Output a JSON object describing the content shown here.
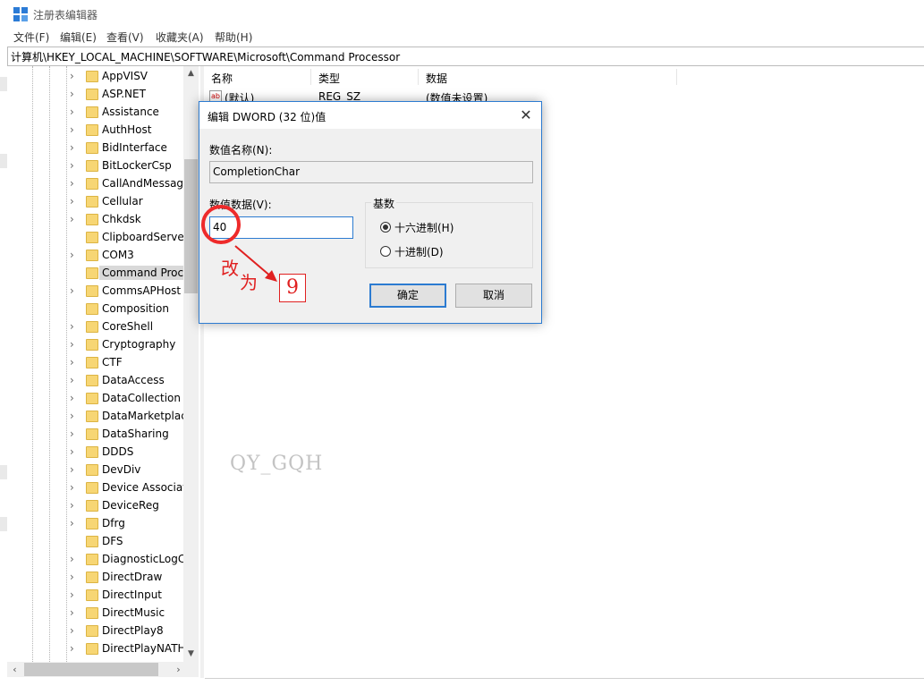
{
  "window": {
    "title": "注册表编辑器",
    "icon": "registry-editor-icon"
  },
  "menu": [
    "文件(F)",
    "编辑(E)",
    "查看(V)",
    "收藏夹(A)",
    "帮助(H)"
  ],
  "address": "计算机\\HKEY_LOCAL_MACHINE\\SOFTWARE\\Microsoft\\Command Processor",
  "tree": {
    "items": [
      {
        "label": "AppVISV",
        "expandable": true
      },
      {
        "label": "ASP.NET",
        "expandable": true
      },
      {
        "label": "Assistance",
        "expandable": true
      },
      {
        "label": "AuthHost",
        "expandable": true
      },
      {
        "label": "BidInterface",
        "expandable": true
      },
      {
        "label": "BitLockerCsp",
        "expandable": true
      },
      {
        "label": "CallAndMessag",
        "expandable": true
      },
      {
        "label": "Cellular",
        "expandable": true
      },
      {
        "label": "Chkdsk",
        "expandable": true
      },
      {
        "label": "ClipboardServe",
        "expandable": false
      },
      {
        "label": "COM3",
        "expandable": true
      },
      {
        "label": "Command Proc",
        "expandable": false,
        "selected": true
      },
      {
        "label": "CommsAPHost",
        "expandable": true
      },
      {
        "label": "Composition",
        "expandable": false
      },
      {
        "label": "CoreShell",
        "expandable": true
      },
      {
        "label": "Cryptography",
        "expandable": true
      },
      {
        "label": "CTF",
        "expandable": true
      },
      {
        "label": "DataAccess",
        "expandable": true
      },
      {
        "label": "DataCollection",
        "expandable": true
      },
      {
        "label": "DataMarketplac",
        "expandable": true
      },
      {
        "label": "DataSharing",
        "expandable": true
      },
      {
        "label": "DDDS",
        "expandable": true
      },
      {
        "label": "DevDiv",
        "expandable": true
      },
      {
        "label": "Device Associat",
        "expandable": true
      },
      {
        "label": "DeviceReg",
        "expandable": true
      },
      {
        "label": "Dfrg",
        "expandable": true
      },
      {
        "label": "DFS",
        "expandable": false
      },
      {
        "label": "DiagnosticLogC",
        "expandable": true
      },
      {
        "label": "DirectDraw",
        "expandable": true
      },
      {
        "label": "DirectInput",
        "expandable": true
      },
      {
        "label": "DirectMusic",
        "expandable": true
      },
      {
        "label": "DirectPlay8",
        "expandable": true
      },
      {
        "label": "DirectPlayNATH",
        "expandable": true
      }
    ]
  },
  "list": {
    "headers": {
      "name": "名称",
      "type": "类型",
      "data": "数据"
    },
    "rows": [
      {
        "name": "(默认)",
        "type": "REG_SZ",
        "data": "(数值未设置)"
      }
    ]
  },
  "watermark": "QY_GQH",
  "dialog": {
    "title": "编辑 DWORD (32 位)值",
    "name_label": "数值名称(N):",
    "name_value": "CompletionChar",
    "data_label": "数值数据(V):",
    "data_value": "40",
    "base_label": "基数",
    "radio_hex": "十六进制(H)",
    "radio_dec": "十进制(D)",
    "hex_checked": true,
    "ok_label": "确定",
    "cancel_label": "取消"
  },
  "annotation": {
    "text": "改为",
    "new_value": "9",
    "color": "#e02020"
  }
}
